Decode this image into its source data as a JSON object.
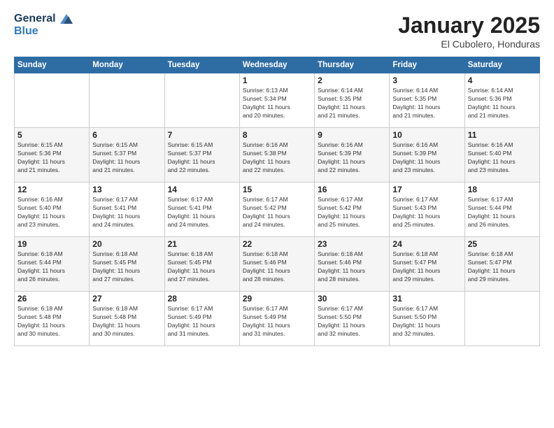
{
  "logo": {
    "line1": "General",
    "line2": "Blue"
  },
  "header": {
    "month": "January 2025",
    "location": "El Cubolero, Honduras"
  },
  "weekdays": [
    "Sunday",
    "Monday",
    "Tuesday",
    "Wednesday",
    "Thursday",
    "Friday",
    "Saturday"
  ],
  "weeks": [
    [
      {
        "day": "",
        "info": ""
      },
      {
        "day": "",
        "info": ""
      },
      {
        "day": "",
        "info": ""
      },
      {
        "day": "1",
        "info": "Sunrise: 6:13 AM\nSunset: 5:34 PM\nDaylight: 11 hours\nand 20 minutes."
      },
      {
        "day": "2",
        "info": "Sunrise: 6:14 AM\nSunset: 5:35 PM\nDaylight: 11 hours\nand 21 minutes."
      },
      {
        "day": "3",
        "info": "Sunrise: 6:14 AM\nSunset: 5:35 PM\nDaylight: 11 hours\nand 21 minutes."
      },
      {
        "day": "4",
        "info": "Sunrise: 6:14 AM\nSunset: 5:36 PM\nDaylight: 11 hours\nand 21 minutes."
      }
    ],
    [
      {
        "day": "5",
        "info": "Sunrise: 6:15 AM\nSunset: 5:36 PM\nDaylight: 11 hours\nand 21 minutes."
      },
      {
        "day": "6",
        "info": "Sunrise: 6:15 AM\nSunset: 5:37 PM\nDaylight: 11 hours\nand 21 minutes."
      },
      {
        "day": "7",
        "info": "Sunrise: 6:15 AM\nSunset: 5:37 PM\nDaylight: 11 hours\nand 22 minutes."
      },
      {
        "day": "8",
        "info": "Sunrise: 6:16 AM\nSunset: 5:38 PM\nDaylight: 11 hours\nand 22 minutes."
      },
      {
        "day": "9",
        "info": "Sunrise: 6:16 AM\nSunset: 5:39 PM\nDaylight: 11 hours\nand 22 minutes."
      },
      {
        "day": "10",
        "info": "Sunrise: 6:16 AM\nSunset: 5:39 PM\nDaylight: 11 hours\nand 23 minutes."
      },
      {
        "day": "11",
        "info": "Sunrise: 6:16 AM\nSunset: 5:40 PM\nDaylight: 11 hours\nand 23 minutes."
      }
    ],
    [
      {
        "day": "12",
        "info": "Sunrise: 6:16 AM\nSunset: 5:40 PM\nDaylight: 11 hours\nand 23 minutes."
      },
      {
        "day": "13",
        "info": "Sunrise: 6:17 AM\nSunset: 5:41 PM\nDaylight: 11 hours\nand 24 minutes."
      },
      {
        "day": "14",
        "info": "Sunrise: 6:17 AM\nSunset: 5:41 PM\nDaylight: 11 hours\nand 24 minutes."
      },
      {
        "day": "15",
        "info": "Sunrise: 6:17 AM\nSunset: 5:42 PM\nDaylight: 11 hours\nand 24 minutes."
      },
      {
        "day": "16",
        "info": "Sunrise: 6:17 AM\nSunset: 5:42 PM\nDaylight: 11 hours\nand 25 minutes."
      },
      {
        "day": "17",
        "info": "Sunrise: 6:17 AM\nSunset: 5:43 PM\nDaylight: 11 hours\nand 25 minutes."
      },
      {
        "day": "18",
        "info": "Sunrise: 6:17 AM\nSunset: 5:44 PM\nDaylight: 11 hours\nand 26 minutes."
      }
    ],
    [
      {
        "day": "19",
        "info": "Sunrise: 6:18 AM\nSunset: 5:44 PM\nDaylight: 11 hours\nand 26 minutes."
      },
      {
        "day": "20",
        "info": "Sunrise: 6:18 AM\nSunset: 5:45 PM\nDaylight: 11 hours\nand 27 minutes."
      },
      {
        "day": "21",
        "info": "Sunrise: 6:18 AM\nSunset: 5:45 PM\nDaylight: 11 hours\nand 27 minutes."
      },
      {
        "day": "22",
        "info": "Sunrise: 6:18 AM\nSunset: 5:46 PM\nDaylight: 11 hours\nand 28 minutes."
      },
      {
        "day": "23",
        "info": "Sunrise: 6:18 AM\nSunset: 5:46 PM\nDaylight: 11 hours\nand 28 minutes."
      },
      {
        "day": "24",
        "info": "Sunrise: 6:18 AM\nSunset: 5:47 PM\nDaylight: 11 hours\nand 29 minutes."
      },
      {
        "day": "25",
        "info": "Sunrise: 6:18 AM\nSunset: 5:47 PM\nDaylight: 11 hours\nand 29 minutes."
      }
    ],
    [
      {
        "day": "26",
        "info": "Sunrise: 6:18 AM\nSunset: 5:48 PM\nDaylight: 11 hours\nand 30 minutes."
      },
      {
        "day": "27",
        "info": "Sunrise: 6:18 AM\nSunset: 5:48 PM\nDaylight: 11 hours\nand 30 minutes."
      },
      {
        "day": "28",
        "info": "Sunrise: 6:17 AM\nSunset: 5:49 PM\nDaylight: 11 hours\nand 31 minutes."
      },
      {
        "day": "29",
        "info": "Sunrise: 6:17 AM\nSunset: 5:49 PM\nDaylight: 11 hours\nand 31 minutes."
      },
      {
        "day": "30",
        "info": "Sunrise: 6:17 AM\nSunset: 5:50 PM\nDaylight: 11 hours\nand 32 minutes."
      },
      {
        "day": "31",
        "info": "Sunrise: 6:17 AM\nSunset: 5:50 PM\nDaylight: 11 hours\nand 32 minutes."
      },
      {
        "day": "",
        "info": ""
      }
    ]
  ]
}
